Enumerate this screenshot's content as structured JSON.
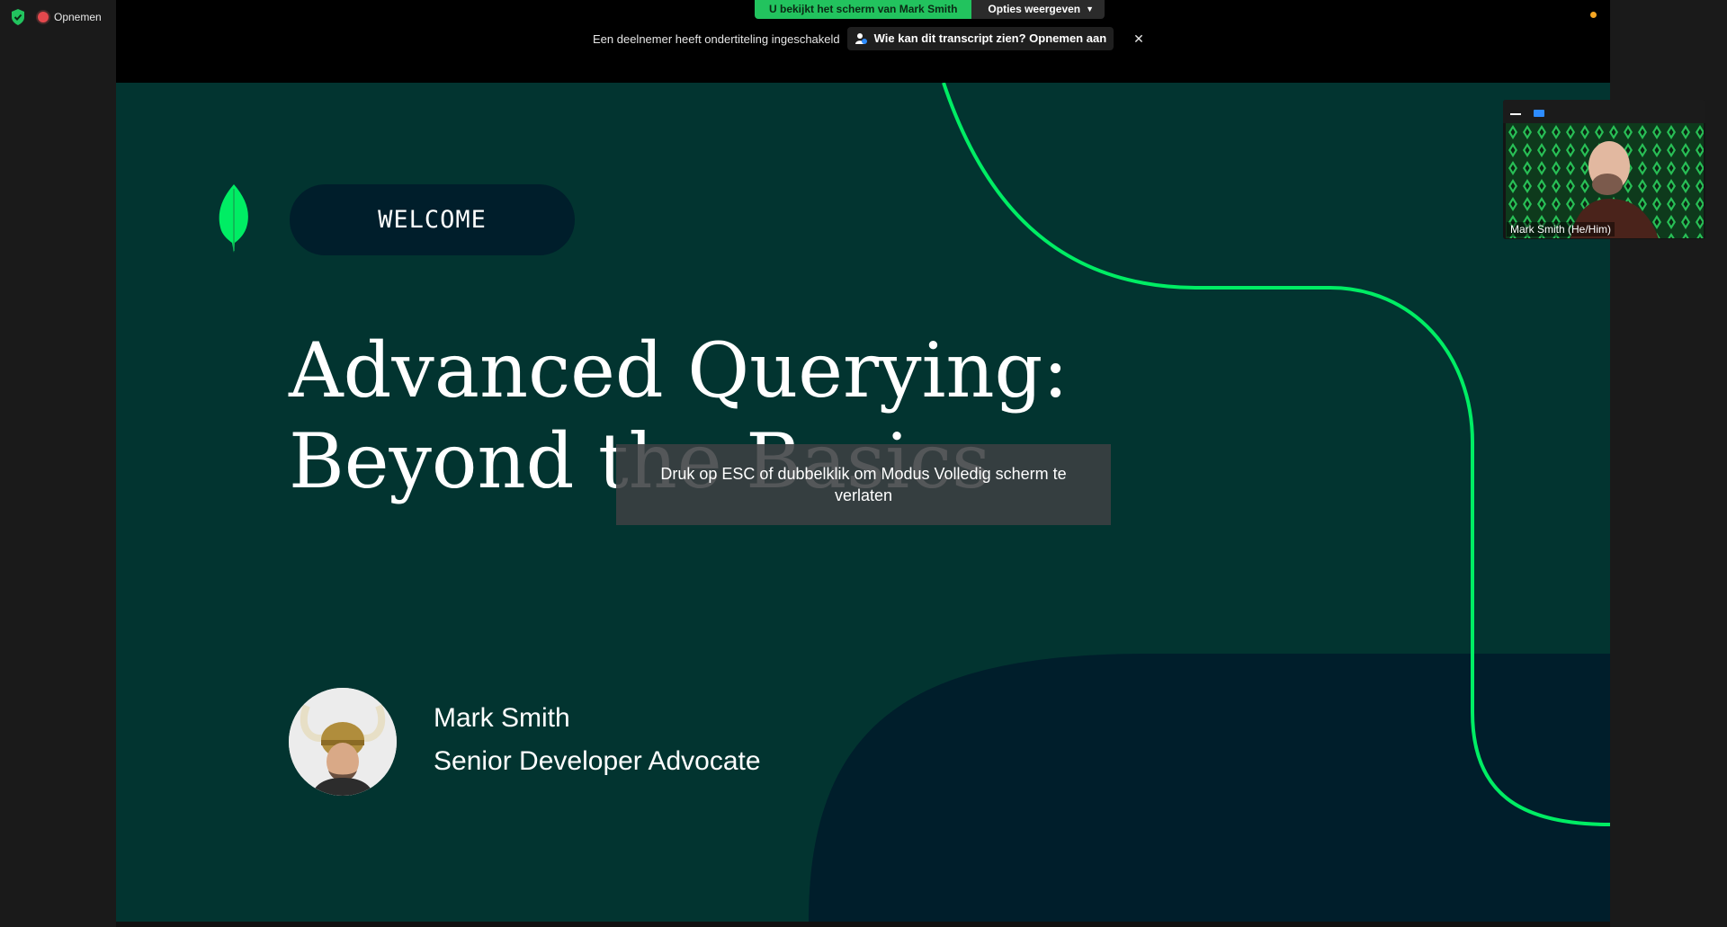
{
  "status": {
    "recording_label": "Opnemen"
  },
  "share_bar": {
    "viewing_text": "U bekijkt het scherm van Mark Smith",
    "options_label": "Opties weergeven"
  },
  "notice": {
    "text": "Een deelnemer heeft ondertiteling ingeschakeld",
    "transcript_button": "Wie kan dit transcript zien? Opnemen aan"
  },
  "slide": {
    "badge": "WELCOME",
    "title_line1": "Advanced Querying:",
    "title_line2": "Beyond the Basics",
    "speaker_name": "Mark Smith",
    "speaker_role": "Senior Developer Advocate",
    "colors": {
      "background": "#023430",
      "accent": "#00ed64",
      "dark": "#001e2b"
    }
  },
  "toast": {
    "text": "Druk op ESC of dubbelklik om Modus Volledig scherm te verlaten"
  },
  "participant": {
    "name": "Mark Smith (He/Him)"
  }
}
